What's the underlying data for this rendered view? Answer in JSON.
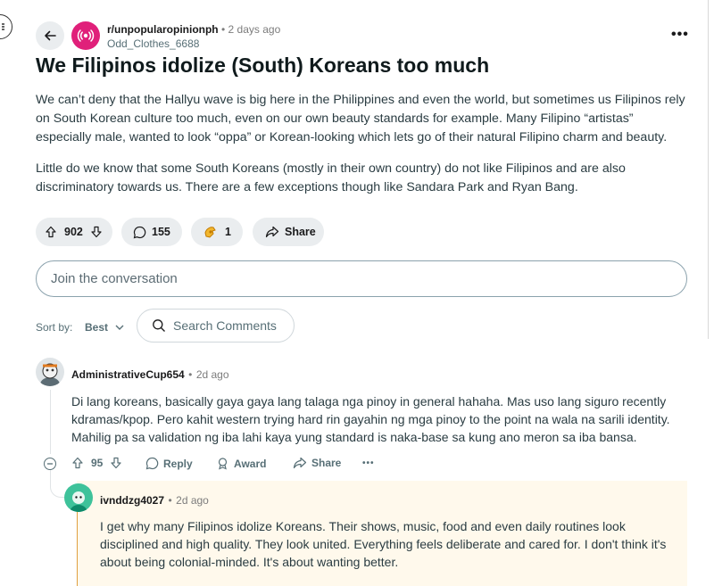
{
  "post": {
    "subreddit": "r/unpopularopinionph",
    "separator": "•",
    "age": "2 days ago",
    "author": "Odd_Clothes_6688",
    "more": "•••",
    "title": "We Filipinos idolize (South) Koreans too much",
    "body": [
      "We can’t deny that the Hallyu wave is big here in the Philippines and even the world, but sometimes us Filipinos rely on South Korean culture too much, even on our own beauty standards for example. Many Filipino “artistas” especially male, wanted to look “oppa” or Korean-looking which lets go of their natural Filipino charm and beauty.",
      "Little do we know that some South Koreans (mostly in their own country) do not like Filipinos and are also discriminatory towards us. There are a few exceptions though like Sandara Park and Ryan Bang."
    ],
    "upvotes": "902",
    "comments": "155",
    "awards": "1",
    "share_label": "Share"
  },
  "composer": {
    "placeholder": "Join the conversation"
  },
  "sort": {
    "label": "Sort by:",
    "value": "Best"
  },
  "search": {
    "placeholder": "Search Comments"
  },
  "comments": [
    {
      "user": "AdministrativeCup654",
      "separator": "•",
      "age": "2d ago",
      "body": "Di lang koreans, basically gaya gaya lang talaga nga pinoy in general hahaha. Mas uso lang siguro recently kdramas/kpop. Pero kahit western trying hard rin gayahin ng mga pinoy to the point na wala na sarili identity. Mahilig pa sa validation ng iba lahi kaya yung standard is naka-base sa kung ano meron sa iba bansa.",
      "votes": "95",
      "actions": {
        "reply": "Reply",
        "award": "Award",
        "share": "Share",
        "more": "•••"
      }
    },
    {
      "user": "ivnddzg4027",
      "separator": "•",
      "age": "2d ago",
      "body": "I get why many Filipinos idolize Koreans. Their shows, music, food and even daily routines look disciplined and high quality. They look united. Everything feels deliberate and cared for. I don't think it's about being colonial-minded. It's about wanting better."
    }
  ],
  "colors": {
    "subreddit_icon": "#e0207a",
    "reply_highlight": "#fff9ec",
    "thread_accent": "#e0a040"
  },
  "icons": [
    "menu-icon",
    "back-arrow-icon",
    "subreddit-icon",
    "upvote-icon",
    "downvote-icon",
    "comment-icon",
    "award-icon",
    "share-icon",
    "chevron-down-icon",
    "search-icon",
    "collapse-icon",
    "reply-icon"
  ]
}
